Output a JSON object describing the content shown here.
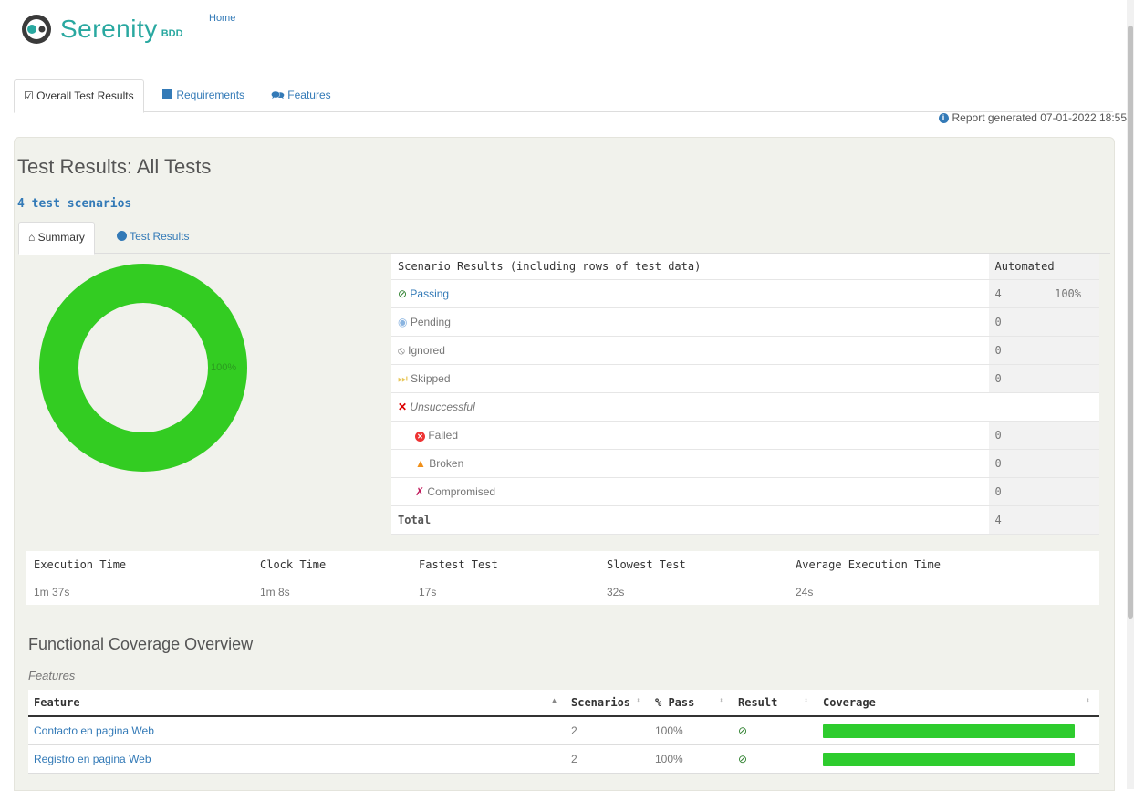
{
  "header": {
    "logo_text": "Serenity",
    "logo_bdd": "BDD",
    "home_link": "Home"
  },
  "top_tabs": [
    {
      "label": "Overall Test Results",
      "icon": "check-square-icon"
    },
    {
      "label": "Requirements",
      "icon": "book-icon"
    },
    {
      "label": "Features",
      "icon": "comments-icon"
    }
  ],
  "report_generated": "Report generated 07-01-2022 18:55",
  "page_title": "Test Results: All Tests",
  "scenario_count": "4 test scenarios",
  "inner_tabs": [
    {
      "label": "Summary",
      "icon": "home-icon"
    },
    {
      "label": "Test Results",
      "icon": "dashboard-icon"
    }
  ],
  "chart_data": {
    "type": "pie",
    "categories": [
      "Passing"
    ],
    "values": [
      100
    ],
    "slice_labels": [
      "100%"
    ],
    "colors": [
      "#33cc22"
    ]
  },
  "scenario_table": {
    "header": "Scenario Results (including rows of test data)",
    "header_col": "Automated",
    "rows": [
      {
        "label": "Passing",
        "count": "4",
        "pct": "100%"
      },
      {
        "label": "Pending",
        "count": "0",
        "pct": ""
      },
      {
        "label": "Ignored",
        "count": "0",
        "pct": ""
      },
      {
        "label": "Skipped",
        "count": "0",
        "pct": ""
      },
      {
        "label": "Unsuccessful",
        "count": "",
        "pct": ""
      },
      {
        "label": "Failed",
        "count": "0",
        "pct": ""
      },
      {
        "label": "Broken",
        "count": "0",
        "pct": ""
      },
      {
        "label": "Compromised",
        "count": "0",
        "pct": ""
      },
      {
        "label": "Total",
        "count": "4",
        "pct": ""
      }
    ]
  },
  "timing": {
    "headers": [
      "Execution Time",
      "Clock Time",
      "Fastest Test",
      "Slowest Test",
      "Average Execution Time"
    ],
    "values": [
      "1m 37s",
      "1m 8s",
      "17s",
      "32s",
      "24s"
    ]
  },
  "coverage": {
    "title": "Functional Coverage Overview",
    "subtitle": "Features",
    "headers": [
      "Feature",
      "Scenarios",
      "% Pass",
      "Result",
      "Coverage"
    ],
    "rows": [
      {
        "feature": "Contacto en pagina Web",
        "scenarios": "2",
        "pass": "100%",
        "coverage_fraction": 1.0
      },
      {
        "feature": "Registro en pagina Web",
        "scenarios": "2",
        "pass": "100%",
        "coverage_fraction": 1.0
      }
    ]
  },
  "colors": {
    "accent": "#337ab7",
    "passing": "#33cc22",
    "brand": "#29a8a0"
  }
}
